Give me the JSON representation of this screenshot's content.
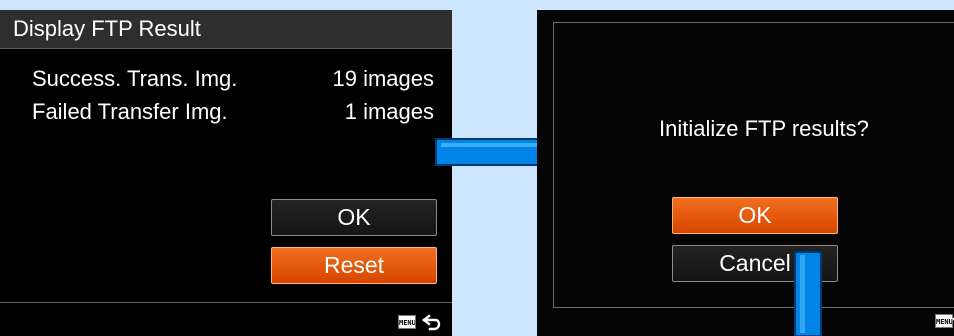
{
  "left_screen": {
    "title": "Display FTP Result",
    "rows": [
      {
        "label": "Success. Trans. Img.",
        "value": "19 images"
      },
      {
        "label": "Failed Transfer Img.",
        "value": "1 images"
      }
    ],
    "buttons": {
      "ok": "OK",
      "reset": "Reset"
    },
    "footer": {
      "menu_icon_text": "MENU",
      "back_icon": "back-arrow-icon"
    }
  },
  "right_screen": {
    "question": "Initialize FTP results?",
    "buttons": {
      "ok": "OK",
      "cancel": "Cancel"
    },
    "footer": {
      "menu_icon_text": "MENU"
    }
  },
  "colors": {
    "page_background": "#cce7ff",
    "screen_background": "#000000",
    "selected_button": "#e45a11",
    "connector_blue": "#0084e6"
  }
}
